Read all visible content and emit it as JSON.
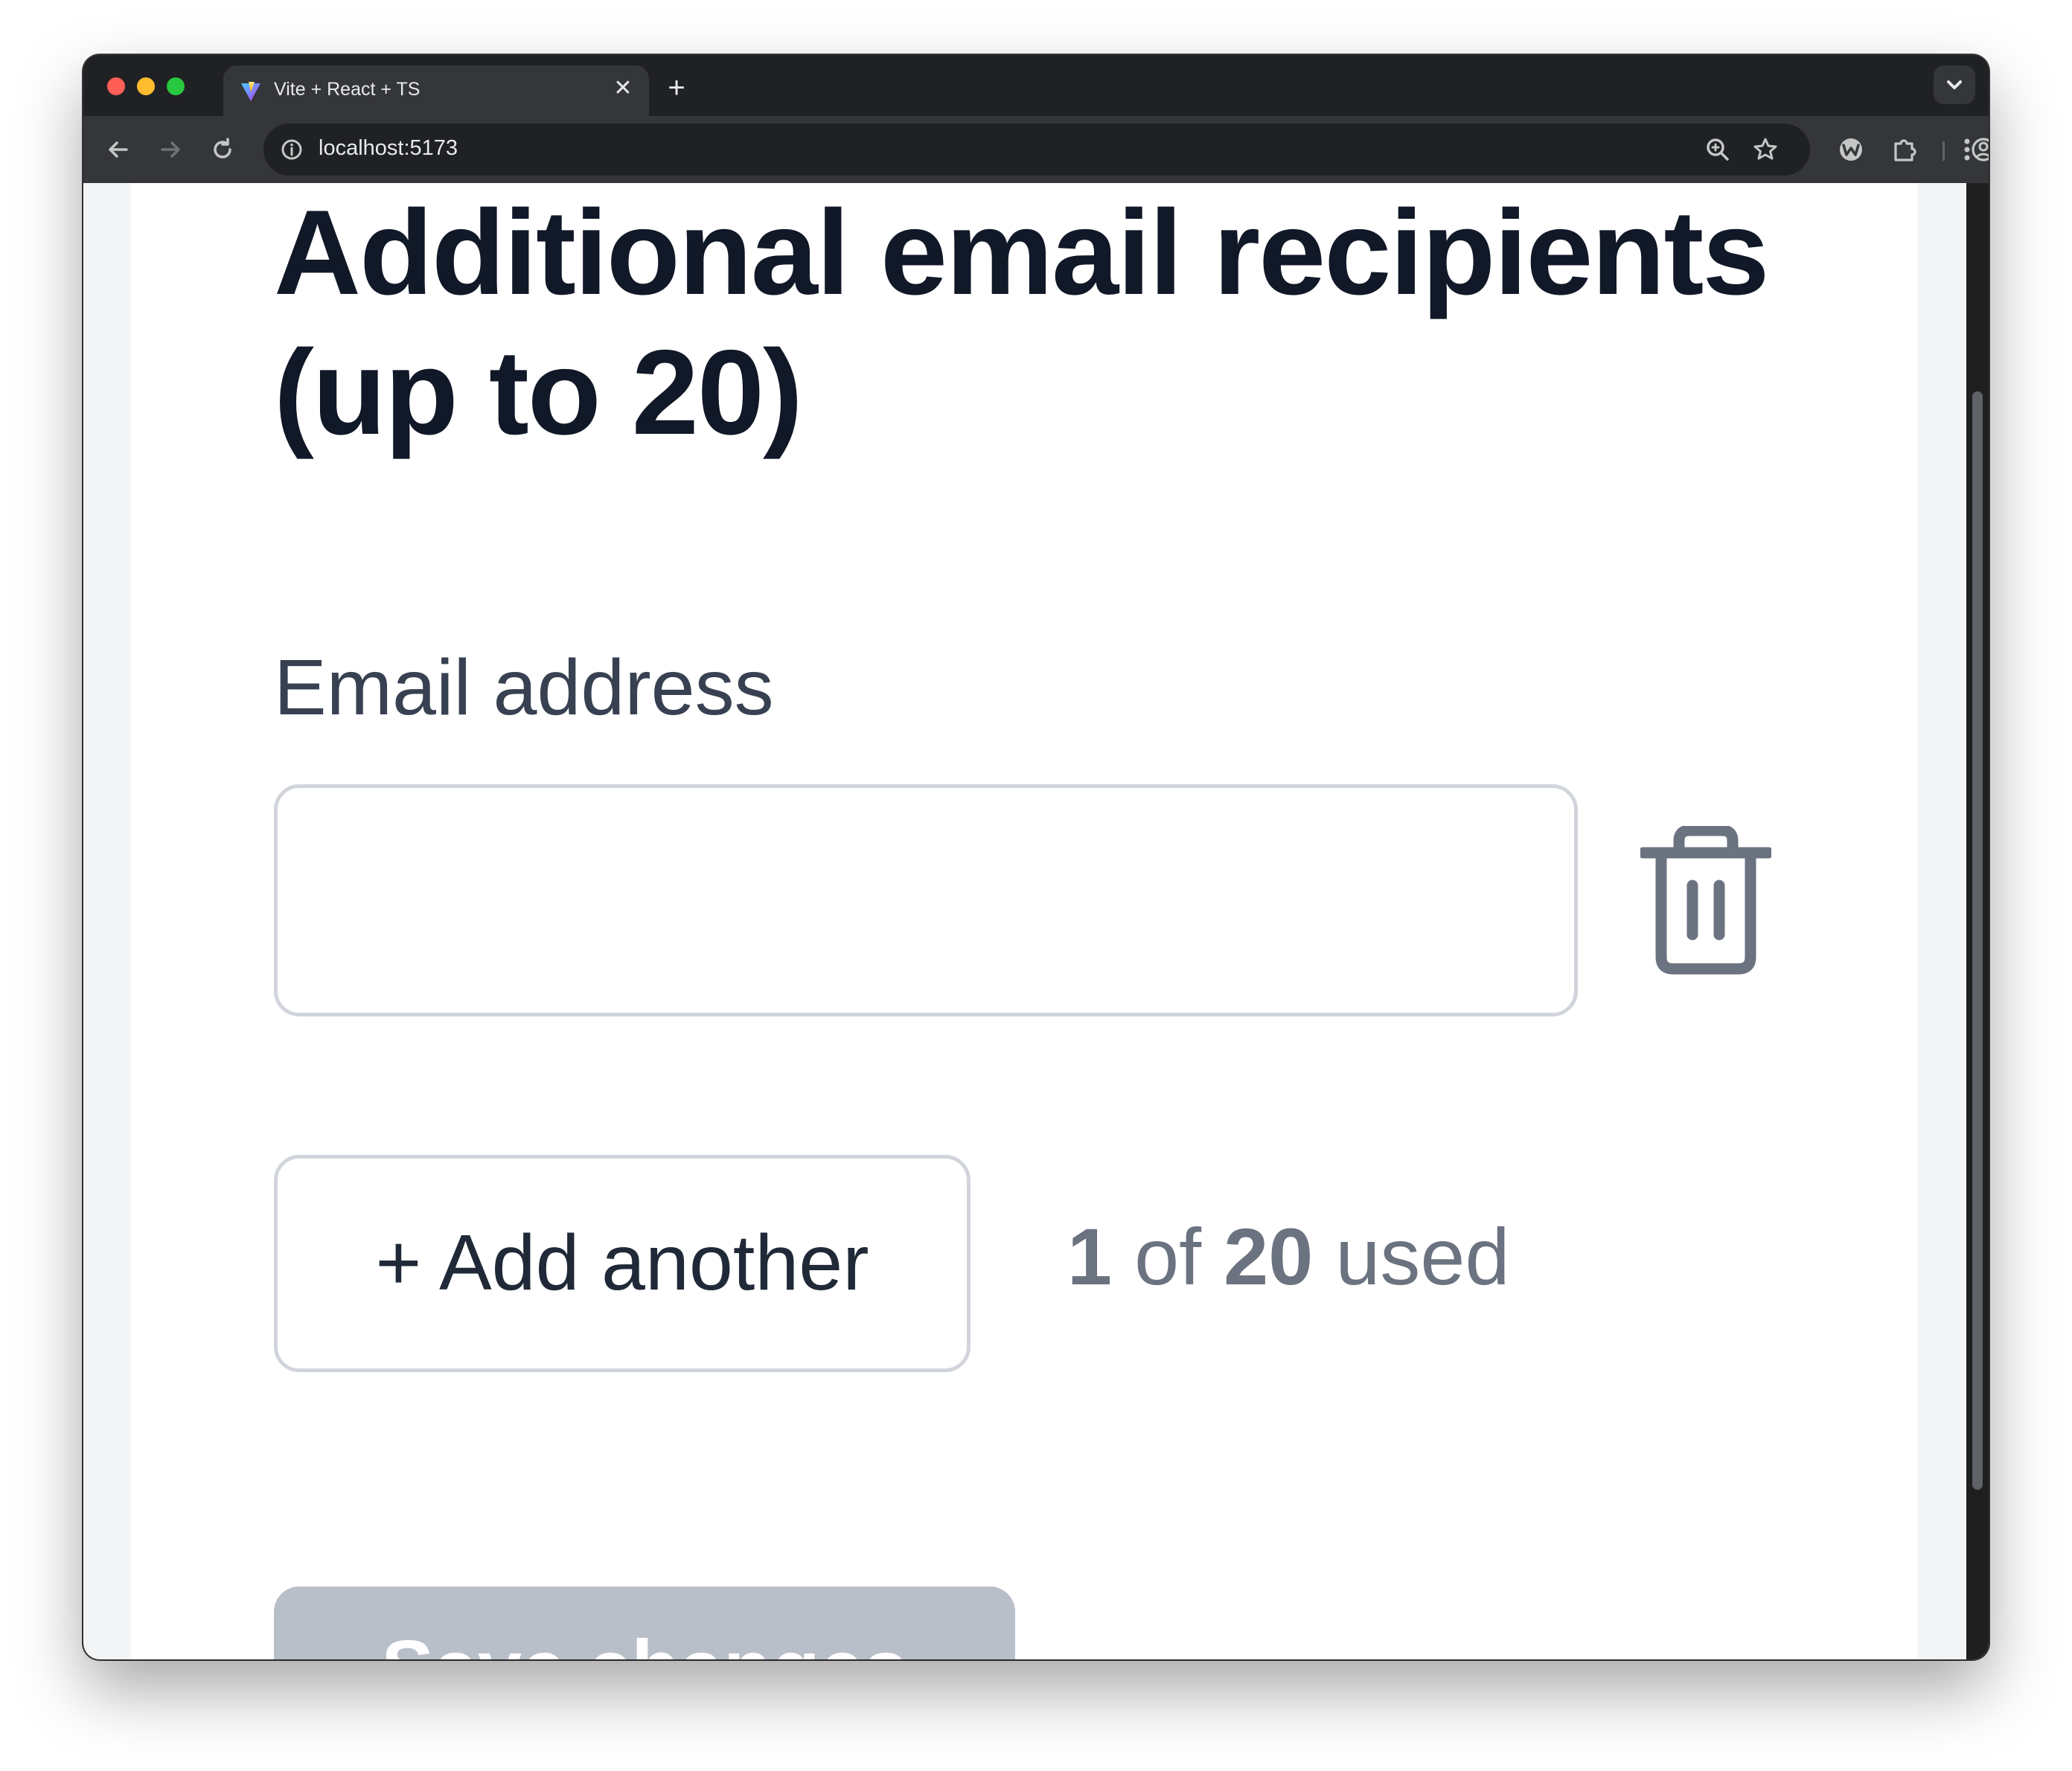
{
  "browser": {
    "tab_title": "Vite + React + TS",
    "tab_close_icon": "x-icon",
    "new_tab_icon": "plus-icon",
    "url": "localhost:5173",
    "colors": {
      "close": "#ff5f57",
      "minimize": "#febc2e",
      "maximize": "#28c840"
    }
  },
  "page": {
    "heading": "Additional email recipients (up to 20)",
    "field_label": "Email address",
    "email_value": "",
    "add_button_label": "+ Add another",
    "usage": {
      "used": "1",
      "of_text": " of ",
      "limit": "20",
      "suffix_text": " used"
    },
    "save_button_label": "Save changes",
    "colors": {
      "heading": "#111827",
      "muted_text": "#6b7280",
      "border": "#d1d5db",
      "disabled_button": "#b9bfc8"
    }
  }
}
